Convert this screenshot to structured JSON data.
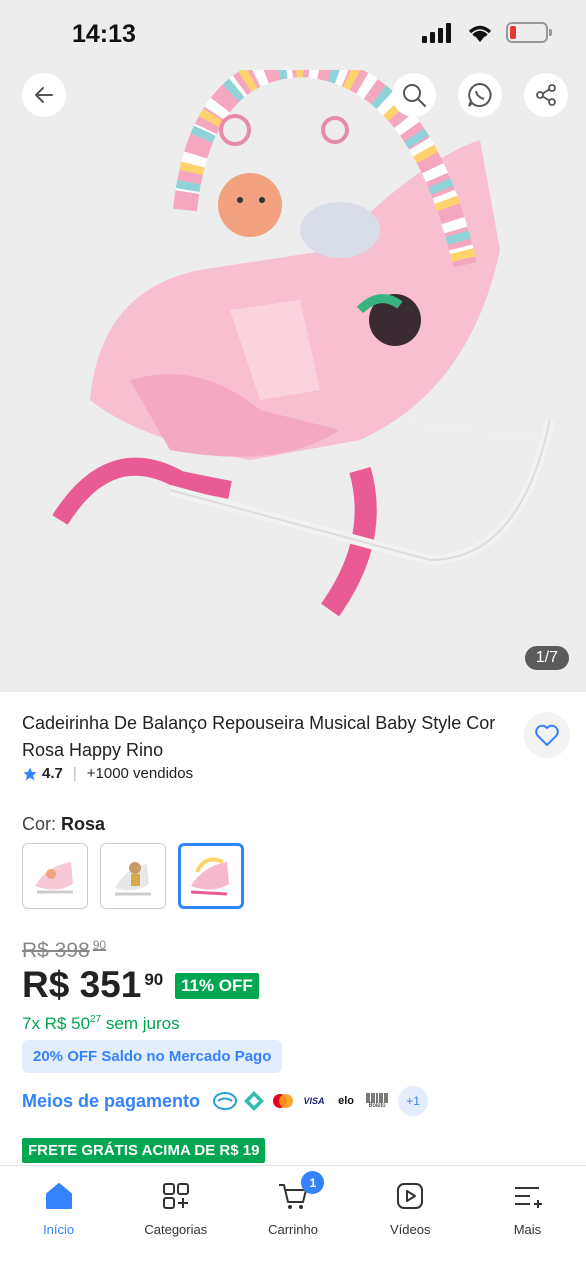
{
  "status_bar": {
    "time": "14:13"
  },
  "gallery": {
    "counter": "1/7",
    "alt": "Cadeirinha de balanço rosa"
  },
  "product": {
    "title": "Cadeirinha De Balanço Repouseira Musical Baby Style Cor Rosa Happy Rino",
    "rating": "4.7",
    "sold": "+1000 vendidos",
    "color_label": "Cor:",
    "color_value": "Rosa",
    "old_price_int": "R$ 398",
    "old_price_cents": "90",
    "price_int": "R$ 351",
    "price_cents": "90",
    "discount": "11% OFF",
    "installments_prefix": "7x R$ 50",
    "installments_cents": "27",
    "installments_suffix": "sem juros",
    "promo": "20% OFF Saldo no Mercado Pago",
    "payments_label": "Meios de pagamento",
    "payments_more": "+1",
    "shipping": "FRETE GRÁTIS ACIMA DE R$ 19"
  },
  "payment_icons": [
    "mercadopago-icon",
    "pix-icon",
    "mastercard-icon",
    "visa-icon",
    "elo-icon",
    "boleto-icon"
  ],
  "payment_text": {
    "visa": "VISA",
    "elo": "elo",
    "boleto": "Boleto"
  },
  "tabs": [
    {
      "label": "Início",
      "icon": "home-icon"
    },
    {
      "label": "Categorias",
      "icon": "categories-icon"
    },
    {
      "label": "Carrinho",
      "icon": "cart-icon",
      "badge": "1"
    },
    {
      "label": "Vídeos",
      "icon": "video-icon"
    },
    {
      "label": "Mais",
      "icon": "more-icon"
    }
  ],
  "colors": {
    "brand_blue": "#3483fa",
    "green": "#00a650",
    "pink": "#f6b8cc"
  }
}
